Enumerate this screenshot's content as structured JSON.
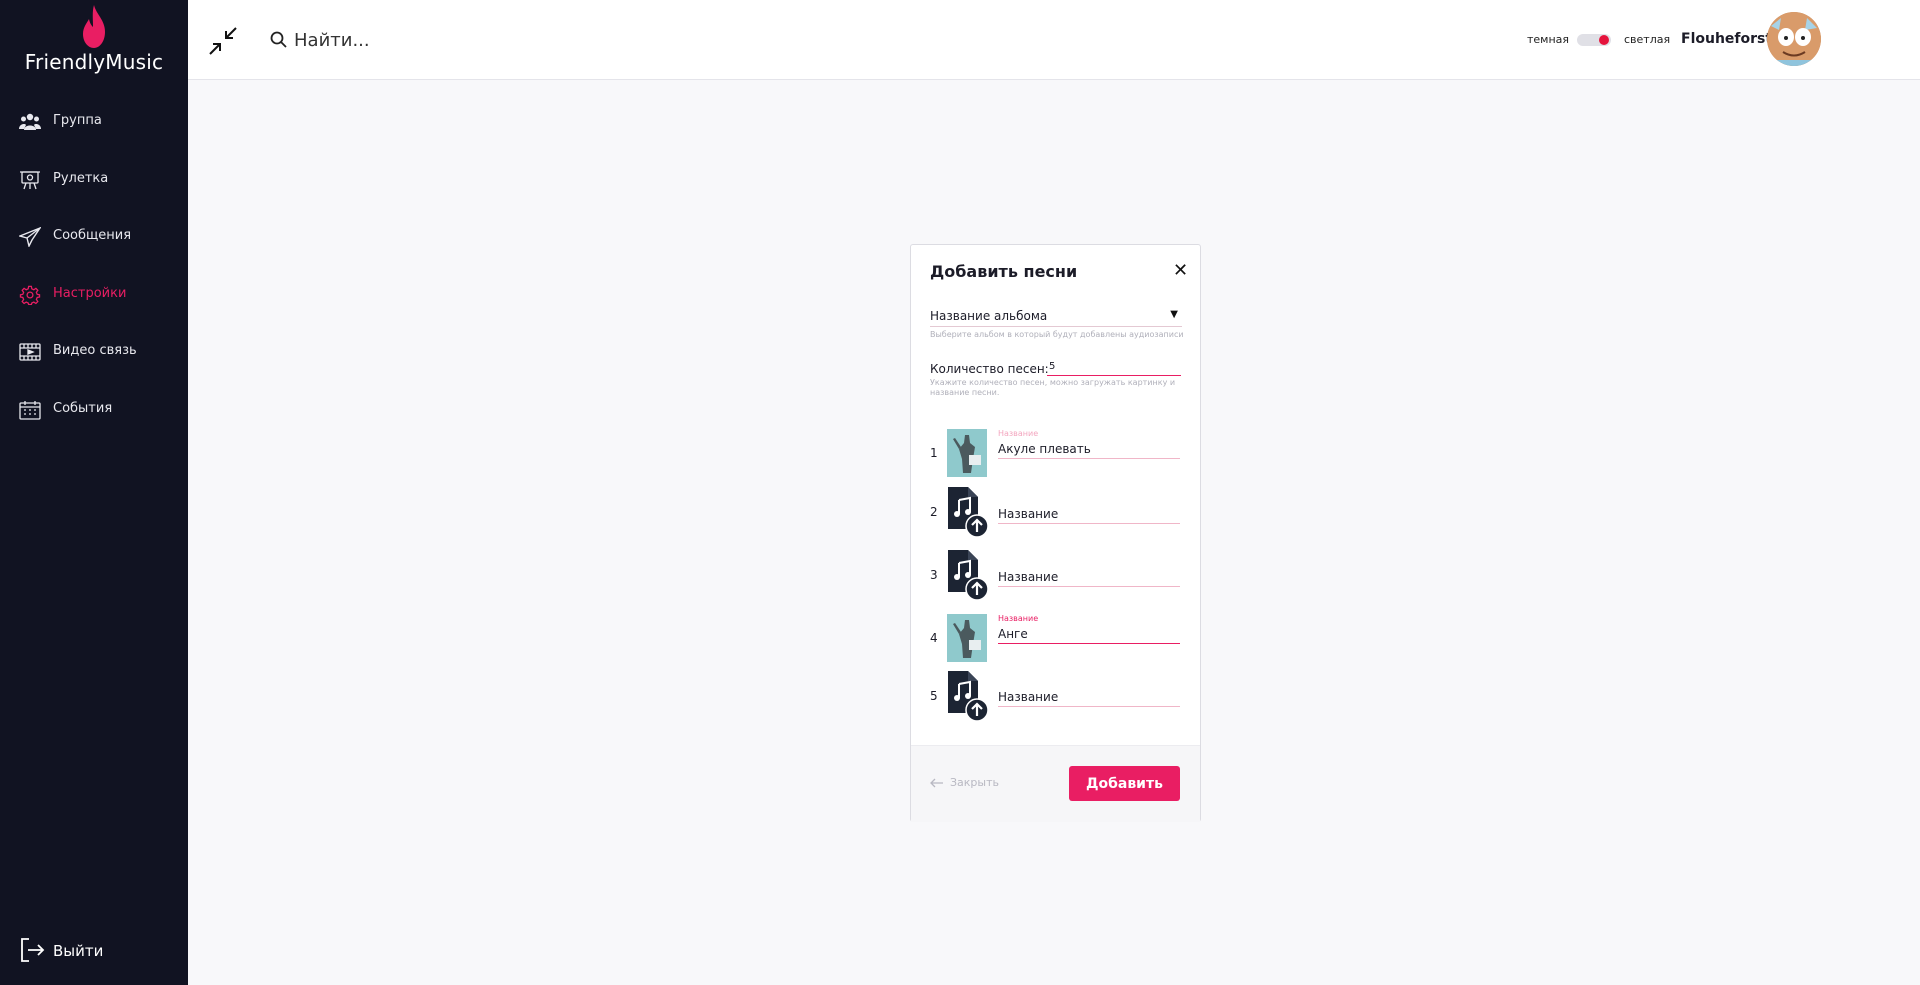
{
  "app": {
    "name": "FriendlyMusic",
    "brand_color": "#e91e63"
  },
  "sidebar": {
    "items": [
      {
        "label": "Группа",
        "icon": "group-icon"
      },
      {
        "label": "Рулетка",
        "icon": "roulette-icon"
      },
      {
        "label": "Сообщения",
        "icon": "send-icon"
      },
      {
        "label": "Настройки",
        "icon": "gear-icon",
        "active": true
      },
      {
        "label": "Видео связь",
        "icon": "video-icon"
      },
      {
        "label": "События",
        "icon": "calendar-icon"
      }
    ],
    "logout_label": "Выйти"
  },
  "header": {
    "search_placeholder": "Найти...",
    "theme_dark_label": "темная",
    "theme_light_label": "светлая",
    "username": "Flouheforst"
  },
  "modal": {
    "title": "Добавить песни",
    "album_select": "Название альбома",
    "album_hint": "Выберите альбом в который будут добавлены аудиозаписи",
    "count_label": "Количество песен:",
    "count_value": "5",
    "count_hint": "Укажите количество песен, можно загружать картинку и название песни.",
    "name_label": "Название",
    "songs": [
      {
        "num": "1",
        "name": "Акуле плевать"
      },
      {
        "num": "2",
        "name": ""
      },
      {
        "num": "3",
        "name": ""
      },
      {
        "num": "4",
        "name": "Анге"
      },
      {
        "num": "5",
        "name": ""
      }
    ],
    "close_label": "Закрыть",
    "add_label": "Добавить"
  }
}
